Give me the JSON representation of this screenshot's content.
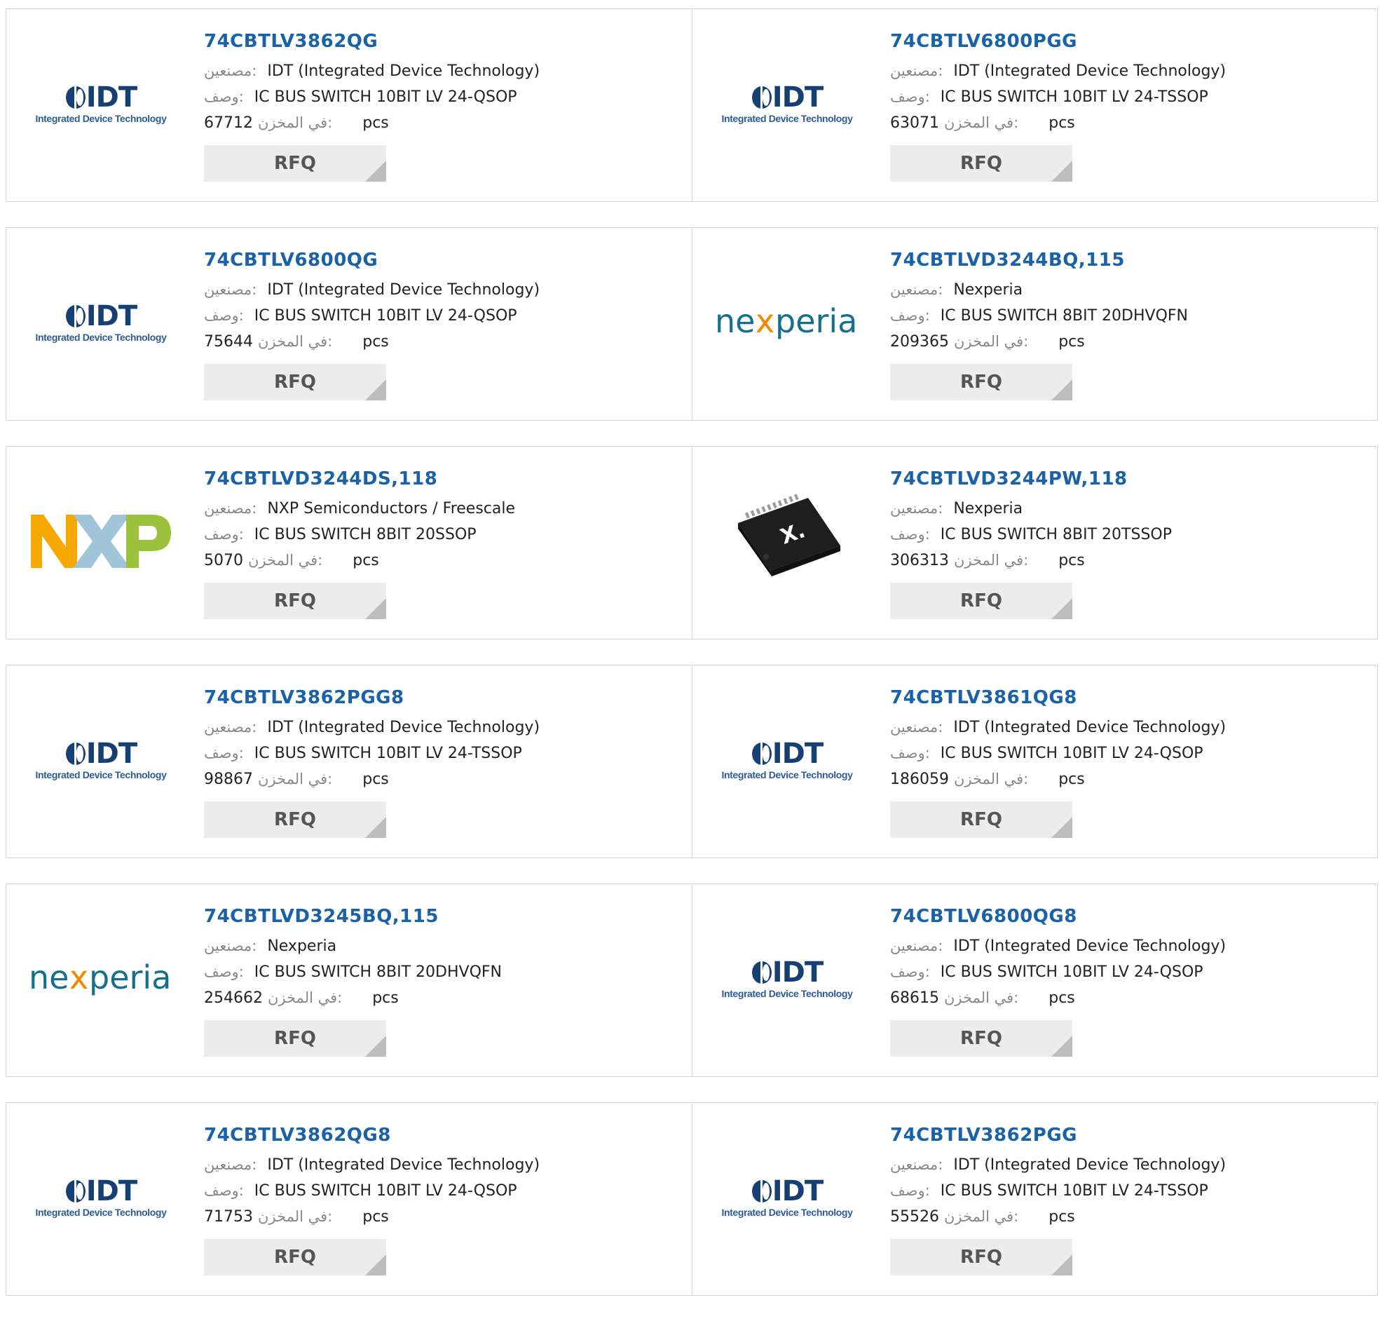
{
  "labels": {
    "manufacturer": "مصنعين:",
    "description": "وصف:",
    "stock": "في المخزن:",
    "unit": "pcs",
    "rfq": "RFQ"
  },
  "colors": {
    "part_link": "#1a62a8",
    "button_bg": "#ececec",
    "border": "#d4d4d4"
  },
  "products": [
    {
      "part": "74CBTLV3862QG",
      "manufacturer": "IDT (Integrated Device Technology)",
      "description": "IC BUS SWITCH 10BIT LV 24-QSOP",
      "stock": "67712",
      "logo": "idt-logo",
      "logo_sub": "Integrated Device Technology",
      "logo_word": "IDT"
    },
    {
      "part": "74CBTLV6800PGG",
      "manufacturer": "IDT (Integrated Device Technology)",
      "description": "IC BUS SWITCH 10BIT LV 24-TSSOP",
      "stock": "63071",
      "logo": "idt-logo",
      "logo_sub": "Integrated Device Technology",
      "logo_word": "IDT"
    },
    {
      "part": "74CBTLV6800QG",
      "manufacturer": "IDT (Integrated Device Technology)",
      "description": "IC BUS SWITCH 10BIT LV 24-QSOP",
      "stock": "75644",
      "logo": "idt-logo",
      "logo_sub": "Integrated Device Technology",
      "logo_word": "IDT"
    },
    {
      "part": "74CBTLVD3244BQ,115",
      "manufacturer": "Nexperia",
      "description": "IC BUS SWITCH 8BIT 20DHVQFN",
      "stock": "209365",
      "logo": "nexperia-logo"
    },
    {
      "part": "74CBTLVD3244DS,118",
      "manufacturer": "NXP Semiconductors / Freescale",
      "description": "IC BUS SWITCH 8BIT 20SSOP",
      "stock": "5070",
      "logo": "nxp-logo"
    },
    {
      "part": "74CBTLVD3244PW,118",
      "manufacturer": "Nexperia",
      "description": "IC BUS SWITCH 8BIT 20TSSOP",
      "stock": "306313",
      "logo": "chip-image"
    },
    {
      "part": "74CBTLV3862PGG8",
      "manufacturer": "IDT (Integrated Device Technology)",
      "description": "IC BUS SWITCH 10BIT LV 24-TSSOP",
      "stock": "98867",
      "logo": "idt-logo",
      "logo_sub": "Integrated Device Technology",
      "logo_word": "IDT"
    },
    {
      "part": "74CBTLV3861QG8",
      "manufacturer": "IDT (Integrated Device Technology)",
      "description": "IC BUS SWITCH 10BIT LV 24-QSOP",
      "stock": "186059",
      "logo": "idt-logo",
      "logo_sub": "Integrated Device Technology",
      "logo_word": "IDT"
    },
    {
      "part": "74CBTLVD3245BQ,115",
      "manufacturer": "Nexperia",
      "description": "IC BUS SWITCH 8BIT 20DHVQFN",
      "stock": "254662",
      "logo": "nexperia-logo"
    },
    {
      "part": "74CBTLV6800QG8",
      "manufacturer": "IDT (Integrated Device Technology)",
      "description": "IC BUS SWITCH 10BIT LV 24-QSOP",
      "stock": "68615",
      "logo": "idt-logo",
      "logo_sub": "Integrated Device Technology",
      "logo_word": "IDT"
    },
    {
      "part": "74CBTLV3862QG8",
      "manufacturer": "IDT (Integrated Device Technology)",
      "description": "IC BUS SWITCH 10BIT LV 24-QSOP",
      "stock": "71753",
      "logo": "idt-logo",
      "logo_sub": "Integrated Device Technology",
      "logo_word": "IDT"
    },
    {
      "part": "74CBTLV3862PGG",
      "manufacturer": "IDT (Integrated Device Technology)",
      "description": "IC BUS SWITCH 10BIT LV 24-TSSOP",
      "stock": "55526",
      "logo": "idt-logo",
      "logo_sub": "Integrated Device Technology",
      "logo_word": "IDT"
    }
  ]
}
